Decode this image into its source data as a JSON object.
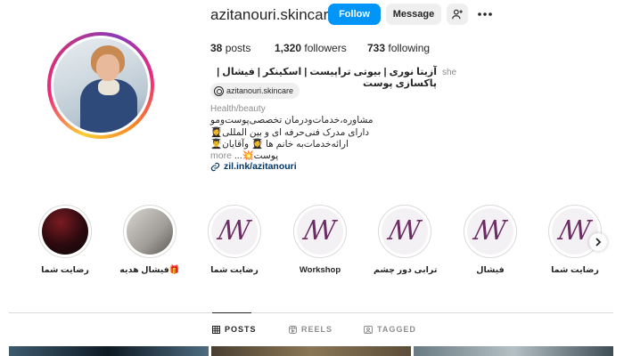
{
  "profile": {
    "username": "azitanouri.skincare",
    "buttons": {
      "follow": "Follow",
      "message": "Message"
    },
    "stats": [
      {
        "count": "38",
        "label": "posts"
      },
      {
        "count": "1,320",
        "label": "followers"
      },
      {
        "count": "733",
        "label": "following"
      }
    ],
    "pronoun": "she",
    "full_name": "آزیتا نوری | بیوتی تراپیست | اسکینکر | فیشال | پاکسازی پوست",
    "threads_handle": "azitanouri.skincare",
    "category": "Health/beauty",
    "bio_lines": [
      "مشاوره،خدمات‌ودرمان تخصصی‌پوست‌ومو",
      "دارای مدرک فنی‌حرفه ای و بین المللی👩‍🎓",
      "ارائه‌خدمات‌به خانم ها 👩‍🎓 وآقایان👨‍🎓",
      "پوست💥..."
    ],
    "more_label": "more",
    "link": "zil.ink/azitanouri"
  },
  "highlights": [
    {
      "label": "رضایت شما",
      "style": "dark"
    },
    {
      "label": "فیشال هدیه🎁",
      "style": "bottle"
    },
    {
      "label": "رضایت شما",
      "style": "logo"
    },
    {
      "label": "Workshop",
      "style": "logo"
    },
    {
      "label": "ترابی دور چشم",
      "style": "logo"
    },
    {
      "label": "فیشال",
      "style": "logo"
    },
    {
      "label": "رضایت شما",
      "style": "logo"
    }
  ],
  "tabs": [
    {
      "label": "POSTS",
      "active": true
    },
    {
      "label": "REELS",
      "active": false
    },
    {
      "label": "TAGGED",
      "active": false
    }
  ],
  "colors": {
    "follow_button": "#0095f6",
    "link": "#00376b",
    "muted": "#8e8e8e",
    "logo_purple": "#6b2c63"
  }
}
